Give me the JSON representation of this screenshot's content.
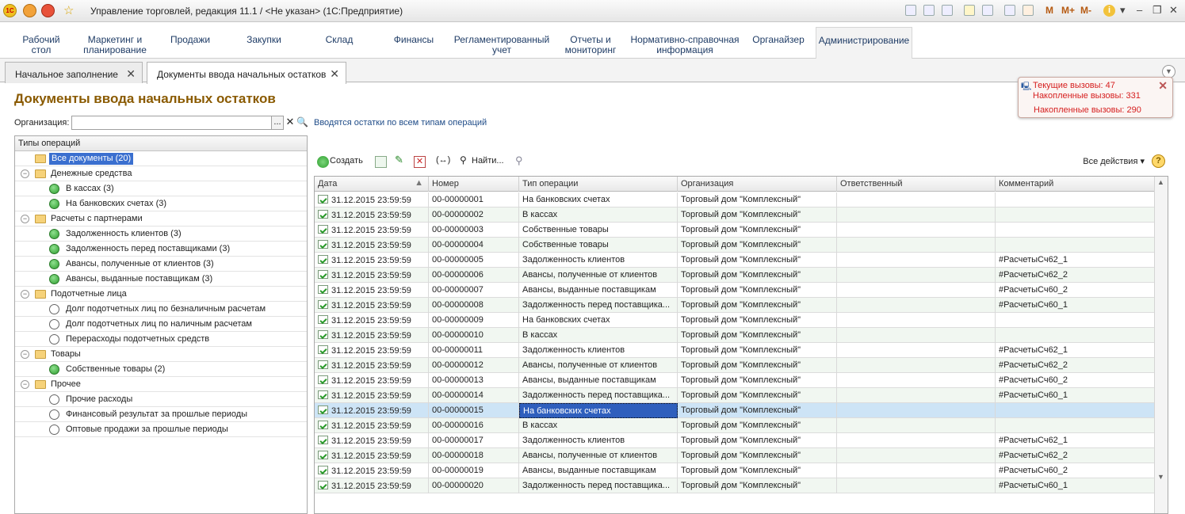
{
  "titlebar": {
    "logo": "1С",
    "title": "Управление торговлей, редакция 11.1 / <Не указан>  (1С:Предприятие)",
    "m1": "M",
    "m2": "M+",
    "m3": "M-"
  },
  "sections": [
    {
      "label1": "Рабочий",
      "label2": "стол"
    },
    {
      "label1": "Маркетинг и",
      "label2": "планирование"
    },
    {
      "label1": "Продажи",
      "label2": ""
    },
    {
      "label1": "Закупки",
      "label2": ""
    },
    {
      "label1": "Склад",
      "label2": ""
    },
    {
      "label1": "Финансы",
      "label2": ""
    },
    {
      "label1": "Регламентированный",
      "label2": "учет"
    },
    {
      "label1": "Отчеты и",
      "label2": "мониторинг"
    },
    {
      "label1": "Нормативно-справочная",
      "label2": "информация"
    },
    {
      "label1": "Органайзер",
      "label2": ""
    },
    {
      "label1": "Администрирование",
      "label2": ""
    }
  ],
  "open_tabs": [
    {
      "label": "Начальное заполнение"
    },
    {
      "label": "Документы ввода начальных остатков"
    }
  ],
  "page_title": "Документы ввода начальных остатков",
  "filter": {
    "org_label": "Организация:",
    "org_value": "",
    "hint": "Вводятся остатки по всем типам операций"
  },
  "popup": {
    "line1": "Текущие вызовы: 47",
    "line2": "Накопленные вызовы: 331",
    "line3": "Накопленные вызовы: 290"
  },
  "tree": {
    "header": "Типы операций",
    "items": [
      {
        "label": "Все документы (20)",
        "level": 0,
        "kind": "root"
      },
      {
        "label": "Денежные средства",
        "level": 0,
        "kind": "group"
      },
      {
        "label": "В кассах (3)",
        "level": 1,
        "kind": "on"
      },
      {
        "label": "На банковских счетах (3)",
        "level": 1,
        "kind": "on"
      },
      {
        "label": "Расчеты с партнерами",
        "level": 0,
        "kind": "group"
      },
      {
        "label": "Задолженность клиентов (3)",
        "level": 1,
        "kind": "on"
      },
      {
        "label": "Задолженность перед поставщиками (3)",
        "level": 1,
        "kind": "on"
      },
      {
        "label": "Авансы, полученные от клиентов (3)",
        "level": 1,
        "kind": "on"
      },
      {
        "label": "Авансы, выданные поставщикам (3)",
        "level": 1,
        "kind": "on"
      },
      {
        "label": "Подотчетные лица",
        "level": 0,
        "kind": "group"
      },
      {
        "label": "Долг подотчетных лиц по безналичным расчетам",
        "level": 1,
        "kind": "off"
      },
      {
        "label": "Долг подотчетных лиц по наличным расчетам",
        "level": 1,
        "kind": "off"
      },
      {
        "label": "Перерасходы подотчетных средств",
        "level": 1,
        "kind": "off"
      },
      {
        "label": "Товары",
        "level": 0,
        "kind": "group"
      },
      {
        "label": "Собственные товары (2)",
        "level": 1,
        "kind": "on"
      },
      {
        "label": "Прочее",
        "level": 0,
        "kind": "group"
      },
      {
        "label": "Прочие расходы",
        "level": 1,
        "kind": "off"
      },
      {
        "label": "Финансовый результат за прошлые периоды",
        "level": 1,
        "kind": "off"
      },
      {
        "label": "Оптовые продажи за прошлые периоды",
        "level": 1,
        "kind": "off"
      }
    ]
  },
  "toolbar": {
    "create": "Создать",
    "find": "Найти...",
    "all_actions": "Все действия",
    "help": "?"
  },
  "grid": {
    "columns": [
      "Дата",
      "Номер",
      "Тип операции",
      "Организация",
      "Ответственный",
      "Комментарий"
    ],
    "selected_row": 14,
    "rows": [
      [
        "31.12.2015 23:59:59",
        "00-00000001",
        "На банковских счетах",
        "Торговый дом \"Комплексный\"",
        "",
        ""
      ],
      [
        "31.12.2015 23:59:59",
        "00-00000002",
        "В кассах",
        "Торговый дом \"Комплексный\"",
        "",
        ""
      ],
      [
        "31.12.2015 23:59:59",
        "00-00000003",
        "Собственные товары",
        "Торговый дом \"Комплексный\"",
        "",
        ""
      ],
      [
        "31.12.2015 23:59:59",
        "00-00000004",
        "Собственные товары",
        "Торговый дом \"Комплексный\"",
        "",
        ""
      ],
      [
        "31.12.2015 23:59:59",
        "00-00000005",
        "Задолженность клиентов",
        "Торговый дом \"Комплексный\"",
        "",
        "#РасчетыСч62_1"
      ],
      [
        "31.12.2015 23:59:59",
        "00-00000006",
        "Авансы, полученные от клиентов",
        "Торговый дом \"Комплексный\"",
        "",
        "#РасчетыСч62_2"
      ],
      [
        "31.12.2015 23:59:59",
        "00-00000007",
        "Авансы, выданные поставщикам",
        "Торговый дом \"Комплексный\"",
        "",
        "#РасчетыСч60_2"
      ],
      [
        "31.12.2015 23:59:59",
        "00-00000008",
        "Задолженность перед поставщика...",
        "Торговый дом \"Комплексный\"",
        "",
        "#РасчетыСч60_1"
      ],
      [
        "31.12.2015 23:59:59",
        "00-00000009",
        "На банковских счетах",
        "Торговый дом \"Комплексный\"",
        "",
        ""
      ],
      [
        "31.12.2015 23:59:59",
        "00-00000010",
        "В кассах",
        "Торговый дом \"Комплексный\"",
        "",
        ""
      ],
      [
        "31.12.2015 23:59:59",
        "00-00000011",
        "Задолженность клиентов",
        "Торговый дом \"Комплексный\"",
        "",
        "#РасчетыСч62_1"
      ],
      [
        "31.12.2015 23:59:59",
        "00-00000012",
        "Авансы, полученные от клиентов",
        "Торговый дом \"Комплексный\"",
        "",
        "#РасчетыСч62_2"
      ],
      [
        "31.12.2015 23:59:59",
        "00-00000013",
        "Авансы, выданные поставщикам",
        "Торговый дом \"Комплексный\"",
        "",
        "#РасчетыСч60_2"
      ],
      [
        "31.12.2015 23:59:59",
        "00-00000014",
        "Задолженность перед поставщика...",
        "Торговый дом \"Комплексный\"",
        "",
        "#РасчетыСч60_1"
      ],
      [
        "31.12.2015 23:59:59",
        "00-00000015",
        "На банковских счетах",
        "Торговый дом \"Комплексный\"",
        "",
        ""
      ],
      [
        "31.12.2015 23:59:59",
        "00-00000016",
        "В кассах",
        "Торговый дом \"Комплексный\"",
        "",
        ""
      ],
      [
        "31.12.2015 23:59:59",
        "00-00000017",
        "Задолженность клиентов",
        "Торговый дом \"Комплексный\"",
        "",
        "#РасчетыСч62_1"
      ],
      [
        "31.12.2015 23:59:59",
        "00-00000018",
        "Авансы, полученные от клиентов",
        "Торговый дом \"Комплексный\"",
        "",
        "#РасчетыСч62_2"
      ],
      [
        "31.12.2015 23:59:59",
        "00-00000019",
        "Авансы, выданные поставщикам",
        "Торговый дом \"Комплексный\"",
        "",
        "#РасчетыСч60_2"
      ],
      [
        "31.12.2015 23:59:59",
        "00-00000020",
        "Задолженность перед поставщика...",
        "Торговый дом \"Комплексный\"",
        "",
        "#РасчетыСч60_1"
      ]
    ]
  },
  "colors": {
    "title": "#8a5a00",
    "section_text": "#1f3c66",
    "selection": "#cde4f6",
    "alert": "#d62020"
  }
}
